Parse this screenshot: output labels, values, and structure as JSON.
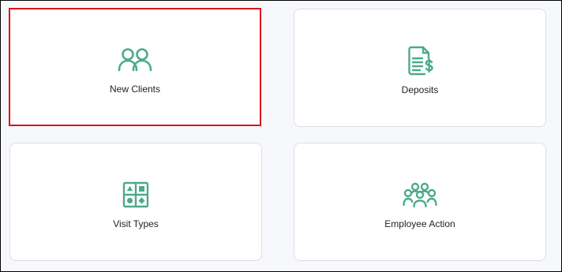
{
  "accent_color": "#4eaa8c",
  "selection_color": "#d9141c",
  "cards": [
    {
      "label": "New Clients",
      "icon": "two-users-icon",
      "selected": true
    },
    {
      "label": "Deposits",
      "icon": "invoice-dollar-icon",
      "selected": false
    },
    {
      "label": "Visit Types",
      "icon": "category-grid-icon",
      "selected": false
    },
    {
      "label": "Employee Action",
      "icon": "team-group-icon",
      "selected": false
    }
  ]
}
